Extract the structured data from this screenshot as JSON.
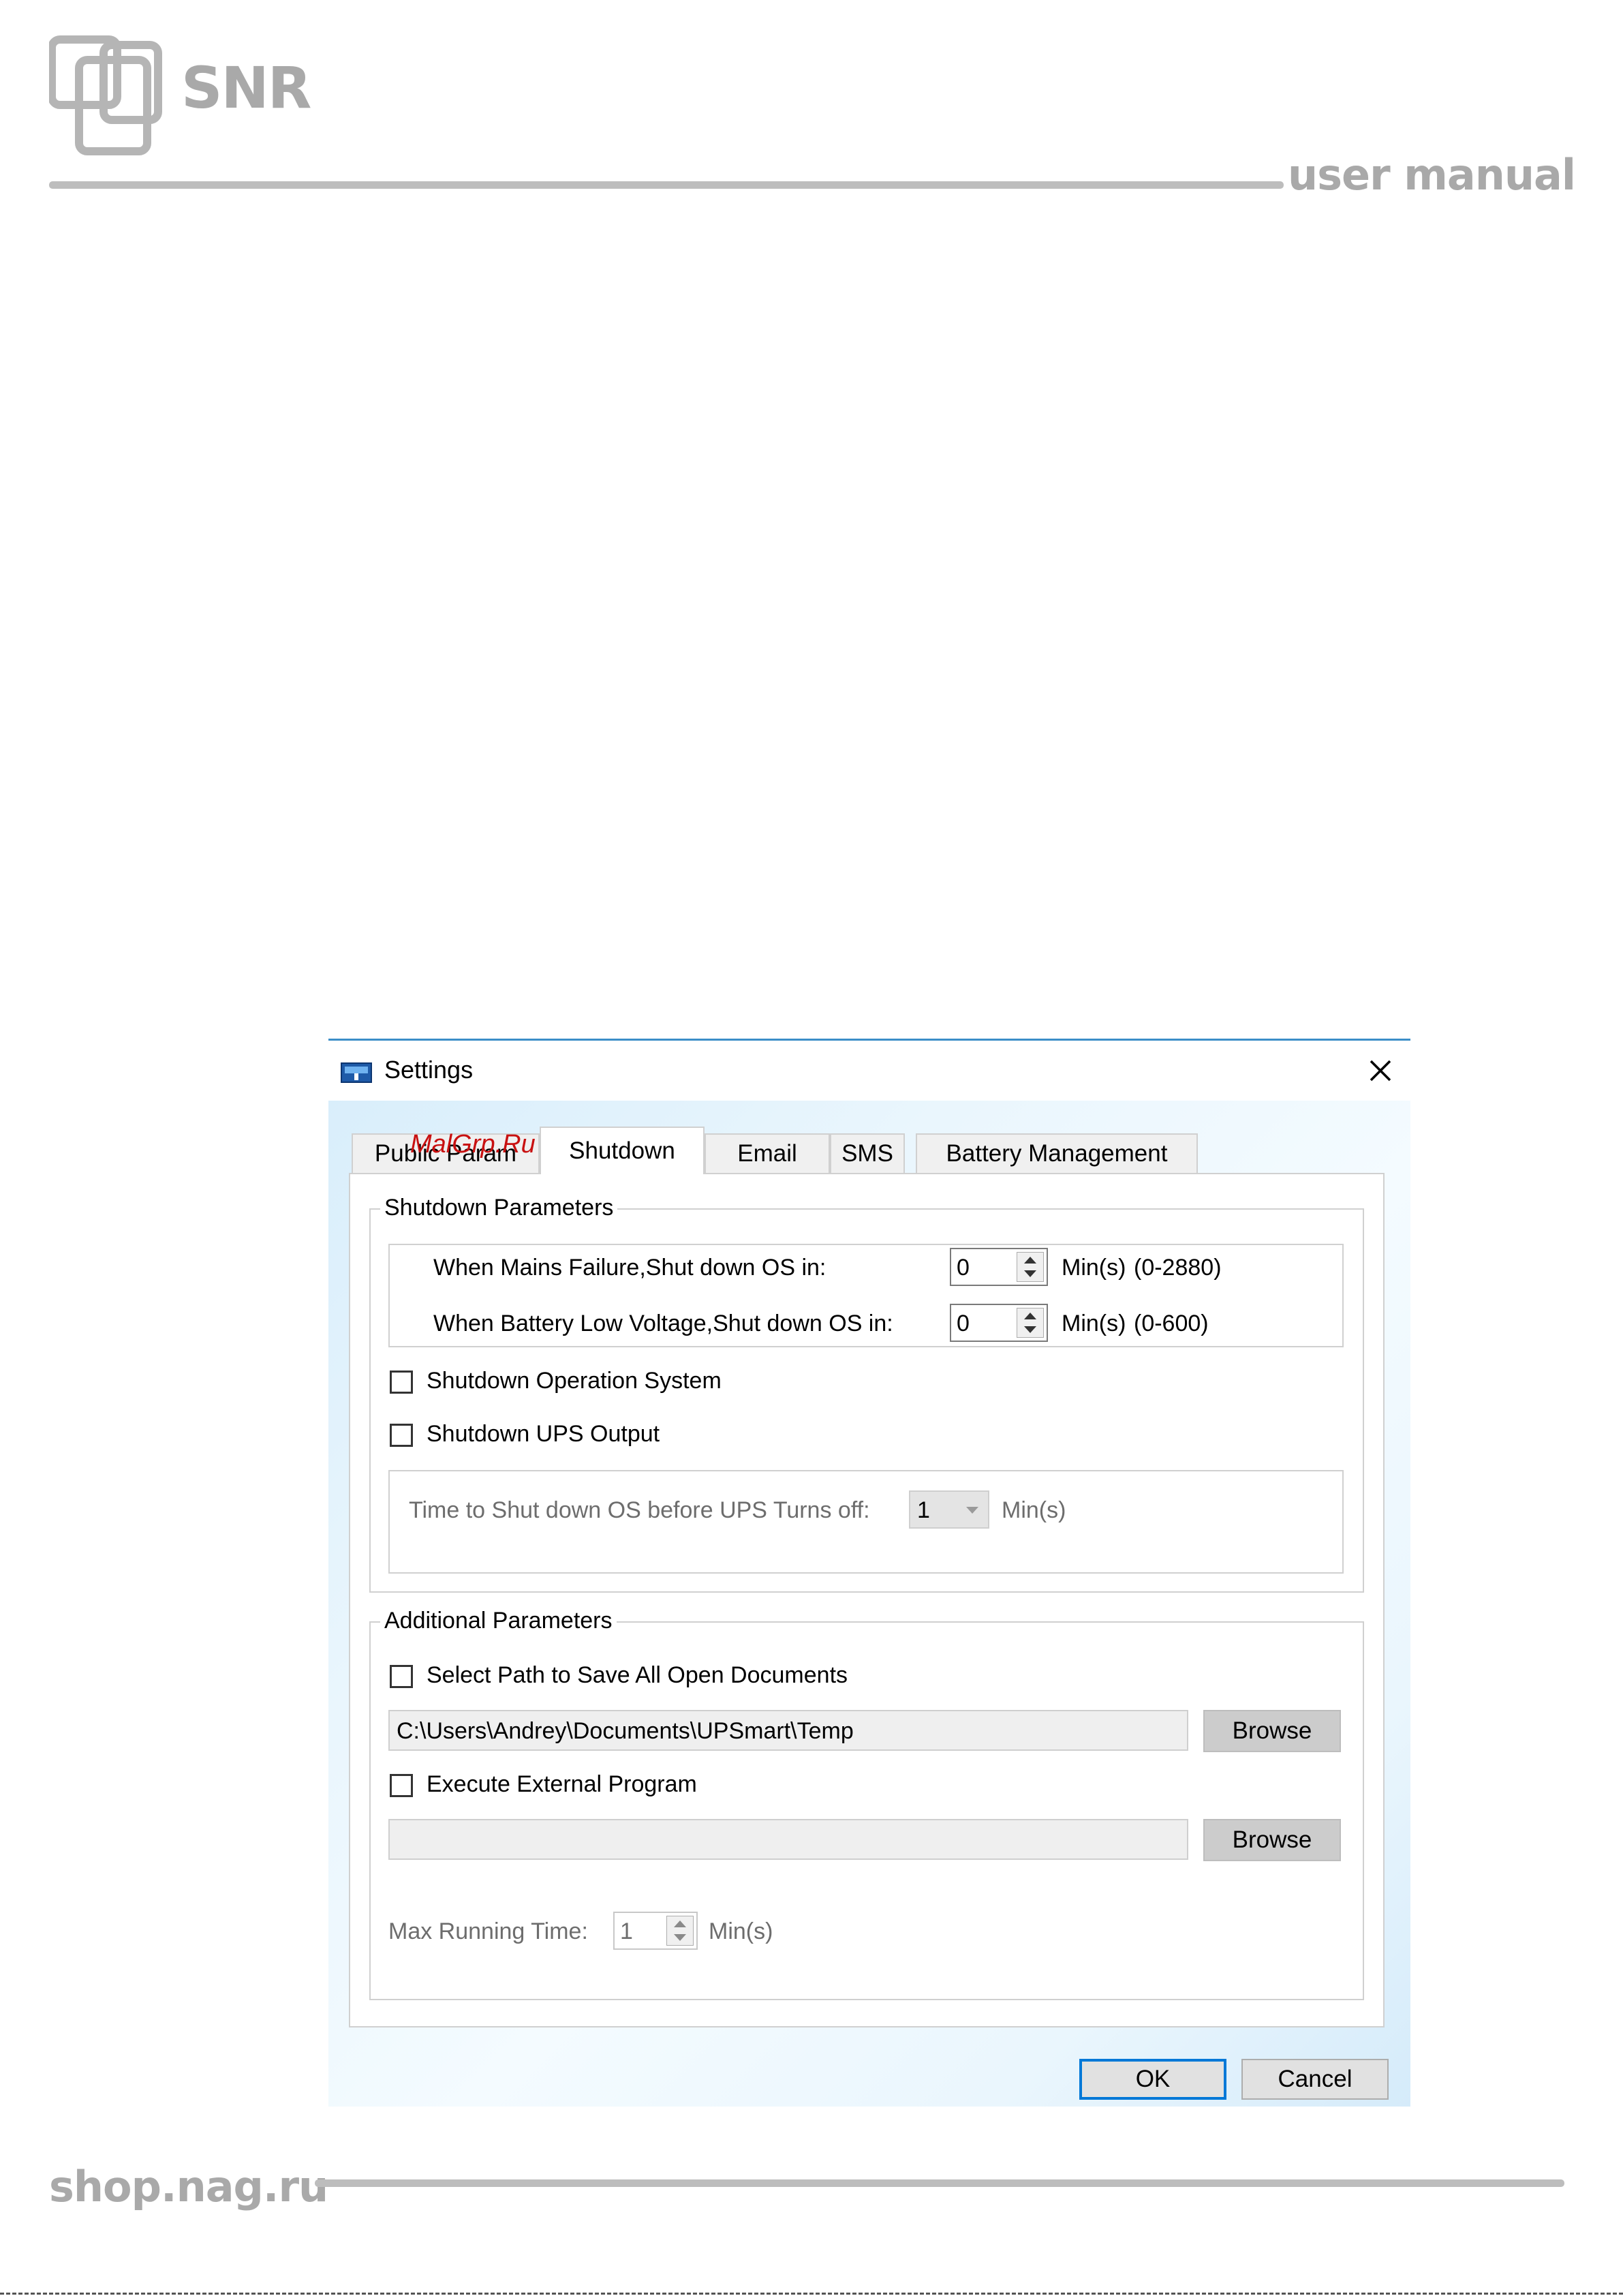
{
  "page": {
    "logo_text": "SNR",
    "header_right": "user manual",
    "footer_left": "shop.nag.ru"
  },
  "dialog": {
    "title": "Settings",
    "tabs": [
      {
        "label": "Public Param",
        "active": false
      },
      {
        "label": "Shutdown",
        "active": true
      },
      {
        "label": "Email",
        "active": false
      },
      {
        "label": "SMS",
        "active": false
      },
      {
        "label": "Battery Management",
        "active": false
      }
    ],
    "watermark": "MalGrp.Ru",
    "shutdown_params": {
      "legend": "Shutdown Parameters",
      "mains_failure_label": "When Mains Failure,Shut down OS in:",
      "mains_failure_value": "0",
      "mains_failure_unit": "Min(s)",
      "mains_failure_range": "(0-2880)",
      "battery_low_label": "When Battery Low Voltage,Shut down OS in:",
      "battery_low_value": "0",
      "battery_low_unit": "Min(s)",
      "battery_low_range": "(0-600)",
      "shutdown_os_label": "Shutdown Operation System",
      "shutdown_os_checked": false,
      "shutdown_ups_label": "Shutdown UPS Output",
      "shutdown_ups_checked": false,
      "time_before_label": "Time to Shut down OS before UPS Turns off:",
      "time_before_value": "1",
      "time_before_unit": "Min(s)"
    },
    "additional_params": {
      "legend": "Additional Parameters",
      "save_path_label": "Select Path to Save All Open Documents",
      "save_path_checked": false,
      "save_path_value": "C:\\Users\\Andrey\\Documents\\UPSmart\\Temp",
      "browse_label": "Browse",
      "execute_label": "Execute External Program",
      "execute_checked": false,
      "execute_path_value": "",
      "browse2_label": "Browse",
      "max_running_label": "Max Running Time:",
      "max_running_value": "1",
      "max_running_unit": "Min(s)"
    },
    "ok_label": "OK",
    "cancel_label": "Cancel"
  },
  "colors": {
    "accent": "#0078d7",
    "title_border": "#3c8ec8",
    "watermark": "#c81010",
    "chrome_gray": "#a9a9a9"
  }
}
